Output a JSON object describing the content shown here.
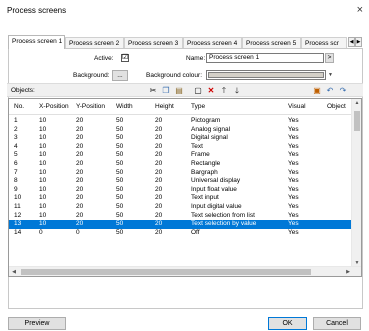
{
  "window": {
    "title": "Process screens",
    "close_glyph": "×"
  },
  "tabs": [
    {
      "label": "Process screen 1",
      "active": true
    },
    {
      "label": "Process screen 2"
    },
    {
      "label": "Process screen 3"
    },
    {
      "label": "Process screen 4"
    },
    {
      "label": "Process screen 5"
    },
    {
      "label": "Process scr"
    }
  ],
  "form": {
    "active_label": "Active:",
    "active_checked": "☑",
    "name_label": "Name:",
    "name_value": "Process screen 1",
    "name_button": ">",
    "background_label": "Background:",
    "background_button": "...",
    "background_colour_label": "Background colour:",
    "background_colour": "#d4d0c8"
  },
  "objects": {
    "label": "Objects:",
    "icons": [
      "cut-icon",
      "copy-icon",
      "paste-icon",
      "new-icon",
      "delete-icon",
      "move-up-icon",
      "move-down-icon",
      "properties-icon",
      "undo-icon",
      "redo-icon"
    ]
  },
  "table": {
    "columns": [
      "No.",
      "X-Position",
      "Y-Position",
      "Width",
      "Height",
      "Type",
      "Visual",
      "Object"
    ],
    "rows": [
      [
        "1",
        "10",
        "20",
        "50",
        "20",
        "Pictogram",
        "Yes"
      ],
      [
        "2",
        "10",
        "20",
        "50",
        "20",
        "Analog signal",
        "Yes"
      ],
      [
        "3",
        "10",
        "20",
        "50",
        "20",
        "Digital signal",
        "Yes"
      ],
      [
        "4",
        "10",
        "20",
        "50",
        "20",
        "Text",
        "Yes"
      ],
      [
        "5",
        "10",
        "20",
        "50",
        "20",
        "Frame",
        "Yes"
      ],
      [
        "6",
        "10",
        "20",
        "50",
        "20",
        "Rectangle",
        "Yes"
      ],
      [
        "7",
        "10",
        "20",
        "50",
        "20",
        "Bargraph",
        "Yes"
      ],
      [
        "8",
        "10",
        "20",
        "50",
        "20",
        "Universal display",
        "Yes"
      ],
      [
        "9",
        "10",
        "20",
        "50",
        "20",
        "Input float value",
        "Yes"
      ],
      [
        "10",
        "10",
        "20",
        "50",
        "20",
        "Text input",
        "Yes"
      ],
      [
        "11",
        "10",
        "20",
        "50",
        "20",
        "Input digital value",
        "Yes"
      ],
      [
        "12",
        "10",
        "20",
        "50",
        "20",
        "Text selection from list",
        "Yes"
      ],
      [
        "13",
        "10",
        "20",
        "50",
        "20",
        "Text selection by value",
        "Yes"
      ],
      [
        "14",
        "0",
        "0",
        "50",
        "20",
        "Off",
        "Yes"
      ]
    ],
    "selected_row": 13
  },
  "footer": {
    "preview": "Preview",
    "ok": "OK",
    "cancel": "Cancel"
  },
  "colors": {
    "accent": "#0078d7"
  }
}
